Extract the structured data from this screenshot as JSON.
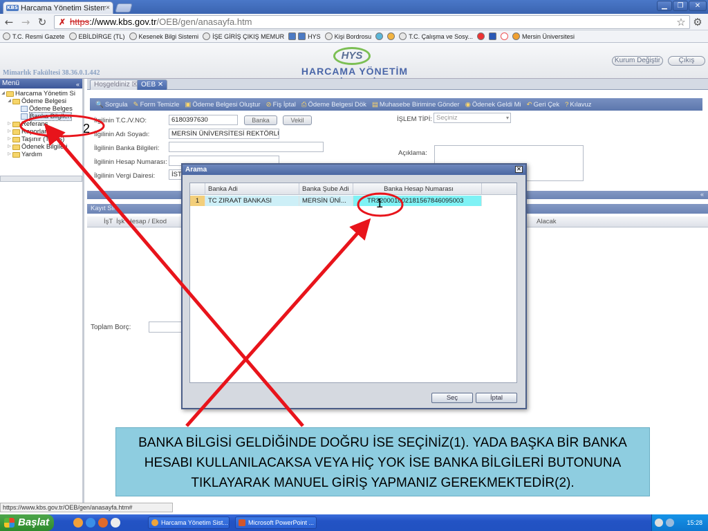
{
  "browser": {
    "tab_title": "Harcama Yönetim Sistemi",
    "tab_favicon_text": "KBS",
    "tab_close": "×",
    "url_scheme": "https",
    "url_host": "://www.kbs.gov.tr",
    "url_path": "/OEB/gen/anasayfa.htm",
    "bookmarks": [
      "T.C. Resmi Gazete",
      "EBİLDİRGE (TL)",
      "Kesenek Bilgi Sistemi",
      "İŞE GİRİŞ ÇIKIŞ MEMUR",
      "HYS",
      "Kişi Bordrosu",
      "T.C. Çalışma ve Sosy...",
      "Mersin Üniversitesi"
    ],
    "status_url": "https://www.kbs.gov.tr/OEB/gen/anasayfa.htm#"
  },
  "header": {
    "logo_text": "HYS",
    "system_title": "HARCAMA YÖNETİM SİSTEMİ",
    "version_text": "Mimarlık Fakültesi 38.36.0.1.442",
    "kurum_button": "Kurum Değiştir",
    "cikis_button": "Çıkış"
  },
  "menu": {
    "title": "Menü",
    "items": [
      {
        "label": "Harcama Yönetim Si"
      },
      {
        "label": "Ödeme Belgesi"
      },
      {
        "label": "Ödeme Belges"
      },
      {
        "label": "Banka Bilgileri"
      },
      {
        "label": "Referans"
      },
      {
        "label": "Raporlar"
      },
      {
        "label": "Taşınır (TKYS)"
      },
      {
        "label": "Ödenek Bilgileri"
      },
      {
        "label": "Yardım"
      }
    ]
  },
  "content": {
    "tabs": [
      "Hoşgeldiniz",
      "OEB"
    ],
    "actions": [
      "Sorgula",
      "Form Temizle",
      "Ödeme Belgesi Oluştur",
      "Fiş İptal",
      "Ödeme Belgesi Dök",
      "Muhasebe Birimine Gönder",
      "Ödenek Geldi Mi",
      "Geri Çek",
      "Kılavuz"
    ],
    "form": {
      "tc_label": "İlgilinin T.C./V.NO:",
      "tc_value": "6180397630",
      "banka_btn": "Banka",
      "vekil_btn": "Vekil",
      "adi_label": "İlgilinin Adı Soyadı:",
      "adi_value": "MERSİN ÜNİVERSİTESİ REKTÖRLÜĞ",
      "banka_label": "İlgilinin Banka Bilgileri:",
      "hesap_label": "İlgilinin Hesap Numarası:",
      "vergi_label": "İlgilinin Vergi Dairesi:",
      "vergi_value": "İST",
      "islem_label": "İŞLEM TİPİ:",
      "islem_placeholder": "Seçiniz",
      "aciklama_label": "Açıklama:"
    },
    "kayit_bar": "Kayıt Sil",
    "grid_columns": [
      "İşT",
      "İşk",
      "Hesap / Ekod",
      "Alacak"
    ],
    "toplam_label": "Toplam Borç:"
  },
  "dialog": {
    "title": "Arama",
    "columns": [
      "Banka Adi",
      "Banka Şube Adi",
      "Banka Hesap Numarası"
    ],
    "rows": [
      {
        "num": "1",
        "banka": "TC ZIRAAT BANKASI",
        "sube": "MERSİN ÜNİ...",
        "iban": "TR320001002181567846095003"
      }
    ],
    "sec_button": "Seç",
    "iptal_button": "İptal"
  },
  "annotation": {
    "label_1": "1",
    "label_2": "2",
    "callout": "BANKA BİLGİSİ GELDİĞİNDE DOĞRU İSE SEÇİNİZ(1). YADA BAŞKA BİR BANKA HESABI KULLANILACAKSA VEYA HİÇ YOK İSE BANKA BİLGİLERİ BUTONUNA TIKLAYARAK MANUEL GİRİŞ YAPMANIZ GEREKMEKTEDİR(2).",
    "color": "#e8141b"
  },
  "taskbar": {
    "start": "Başlat",
    "items": [
      "Harcama Yönetim Sist...",
      "Microsoft PowerPoint ..."
    ],
    "clock": "15:28"
  }
}
